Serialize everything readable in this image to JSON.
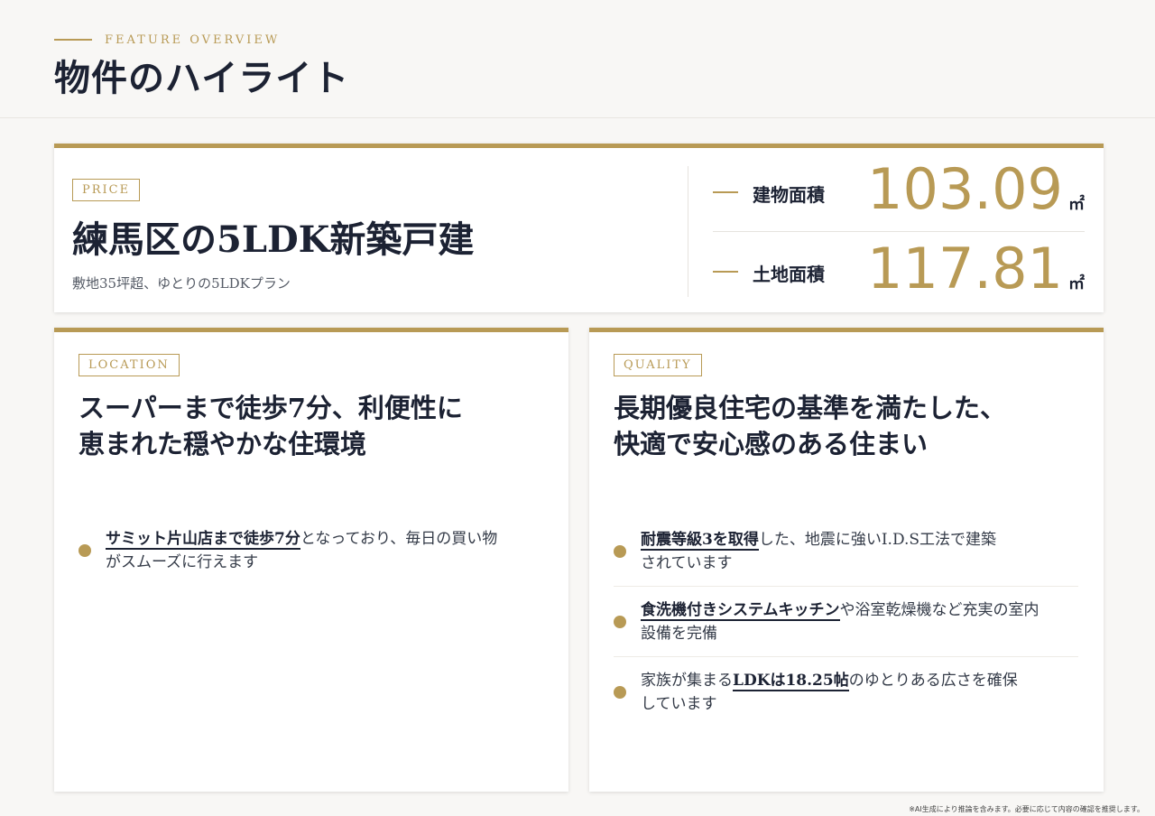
{
  "header": {
    "eyebrow": "FEATURE OVERVIEW",
    "title": "物件のハイライト"
  },
  "price_card": {
    "tag": "PRICE",
    "title": "練馬区の5LDK新築戸建",
    "subtitle": "敷地35坪超、ゆとりの5LDKプラン",
    "specs": [
      {
        "label": "建物面積",
        "value": "103.09",
        "unit": "㎡"
      },
      {
        "label": "土地面積",
        "value": "117.81",
        "unit": "㎡"
      }
    ]
  },
  "location_card": {
    "tag": "LOCATION",
    "heading_line1": "スーパーまで徒歩7分、利便性に",
    "heading_line2": "恵まれた穏やかな住環境",
    "points": [
      {
        "highlight": "サミット片山店まで徒歩7分",
        "text": "となっており、毎日の買い物がスムーズに行えます"
      }
    ]
  },
  "quality_card": {
    "tag": "QUALITY",
    "heading_line1": "長期優良住宅の基準を満たした、",
    "heading_line2": "快適で安心感のある住まい",
    "points": [
      {
        "before": "",
        "highlight": "耐震等級3を取得",
        "text": "した、地震に強いI.D.S工法で建築されています"
      },
      {
        "before": "",
        "highlight": "食洗機付きシステムキッチン",
        "text": "や浴室乾燥機など充実の室内設備を完備"
      },
      {
        "before": "家族が集まる",
        "highlight": "LDKは18.25帖",
        "text": "のゆとりある広さを確保しています"
      }
    ]
  },
  "footnote": "※AI生成により推論を含みます。必要に応じて内容の確認を推奨します。",
  "colors": {
    "accent": "#b89a55",
    "navy": "#1c2233",
    "background": "#f8f7f5"
  }
}
